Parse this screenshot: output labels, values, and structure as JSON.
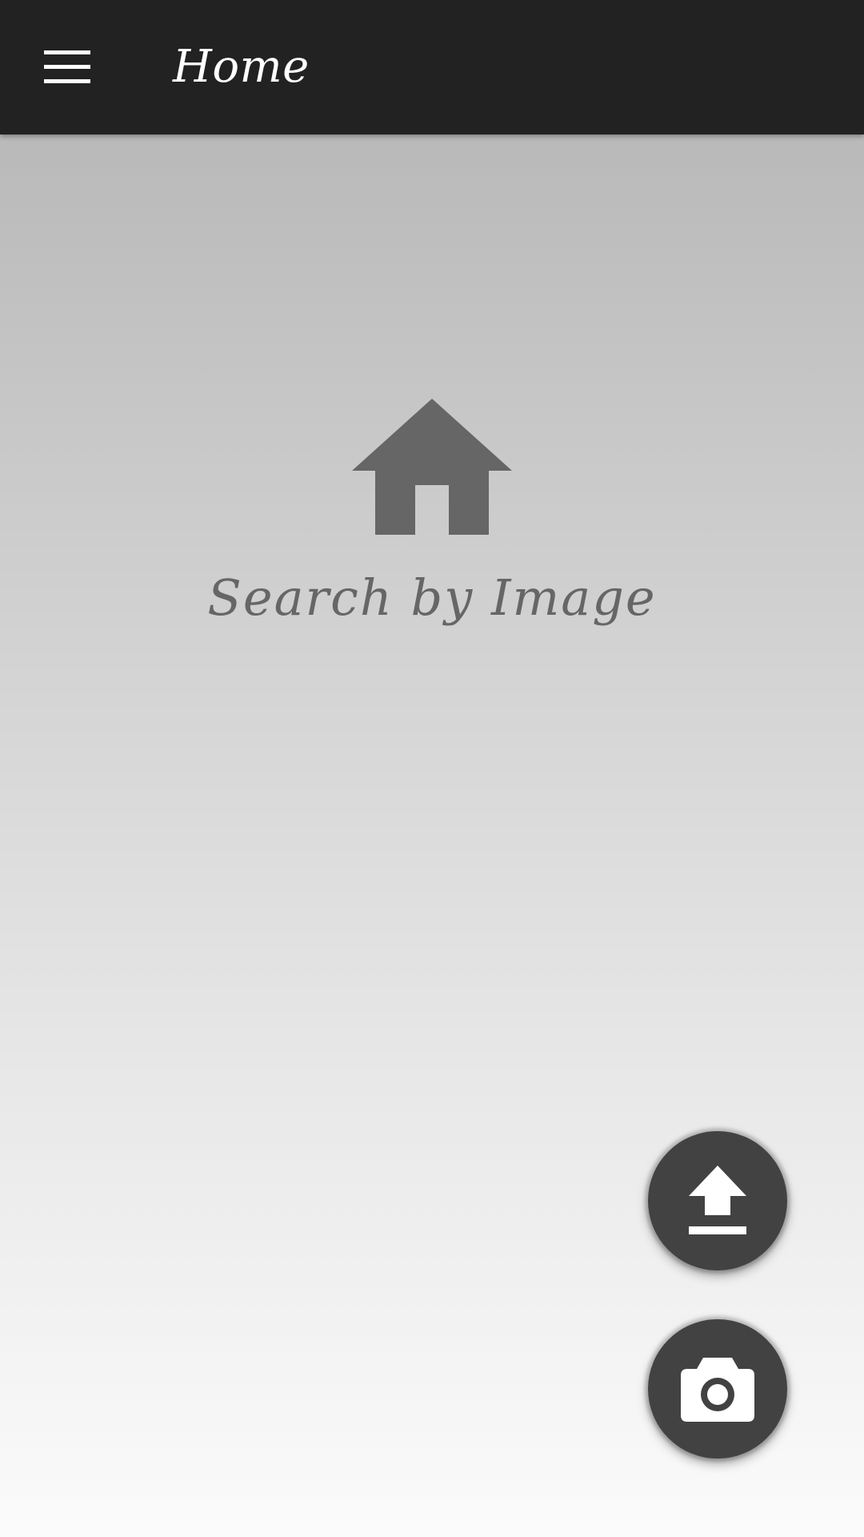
{
  "app_bar": {
    "title": "Home",
    "menu_icon": "hamburger-menu-icon",
    "background": "#222222"
  },
  "empty_state": {
    "icon": "home-icon",
    "label": "Search by Image",
    "color": "#666666"
  },
  "fabs": [
    {
      "icon": "upload-icon",
      "color": "#424242"
    },
    {
      "icon": "camera-icon",
      "color": "#424242"
    }
  ]
}
